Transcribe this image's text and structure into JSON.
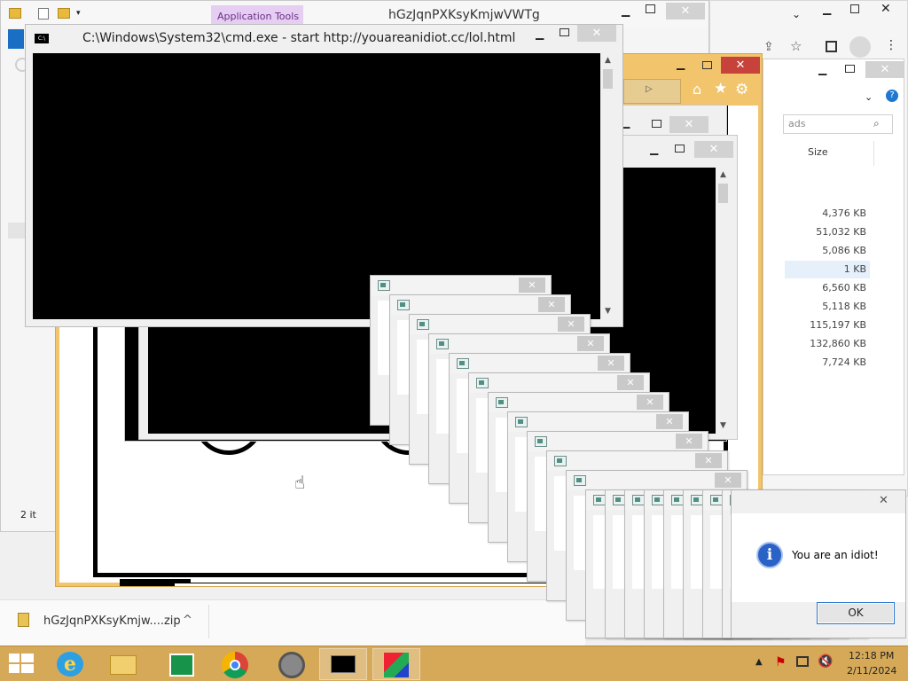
{
  "file_explorer": {
    "app_tools_label": "Application Tools",
    "window_title": "hGzJqnPXKsyKmjwVWTg",
    "search_placeholder": "Search Downloads",
    "search_fragment": "ads",
    "column_size": "Size",
    "file_sizes": [
      "4,376 KB",
      "51,032 KB",
      "5,086 KB",
      "1 KB",
      "6,560 KB",
      "5,118 KB",
      "115,197 KB",
      "132,860 KB",
      "7,724 KB"
    ],
    "selected_row": 3,
    "status_items": "2 it"
  },
  "cmd_window": {
    "icon_text": "C:\\",
    "title": "C:\\Windows\\System32\\cmd.exe - start  http://youareanidiot.cc/lol.html"
  },
  "download_bar": {
    "file_name": "hGzJqnPXKsyKmjw....zip",
    "chevron": "^"
  },
  "message_box": {
    "message": "You are an idiot!",
    "ok_label": "OK",
    "close_glyph": "✕"
  },
  "taskbar": {
    "time": "12:18 PM",
    "date": "2/11/2024"
  },
  "colors": {
    "taskbar": "#d6a958",
    "ie_frame": "#f2c46b",
    "close_red": "#c7423a",
    "info_blue": "#2a62c5"
  }
}
